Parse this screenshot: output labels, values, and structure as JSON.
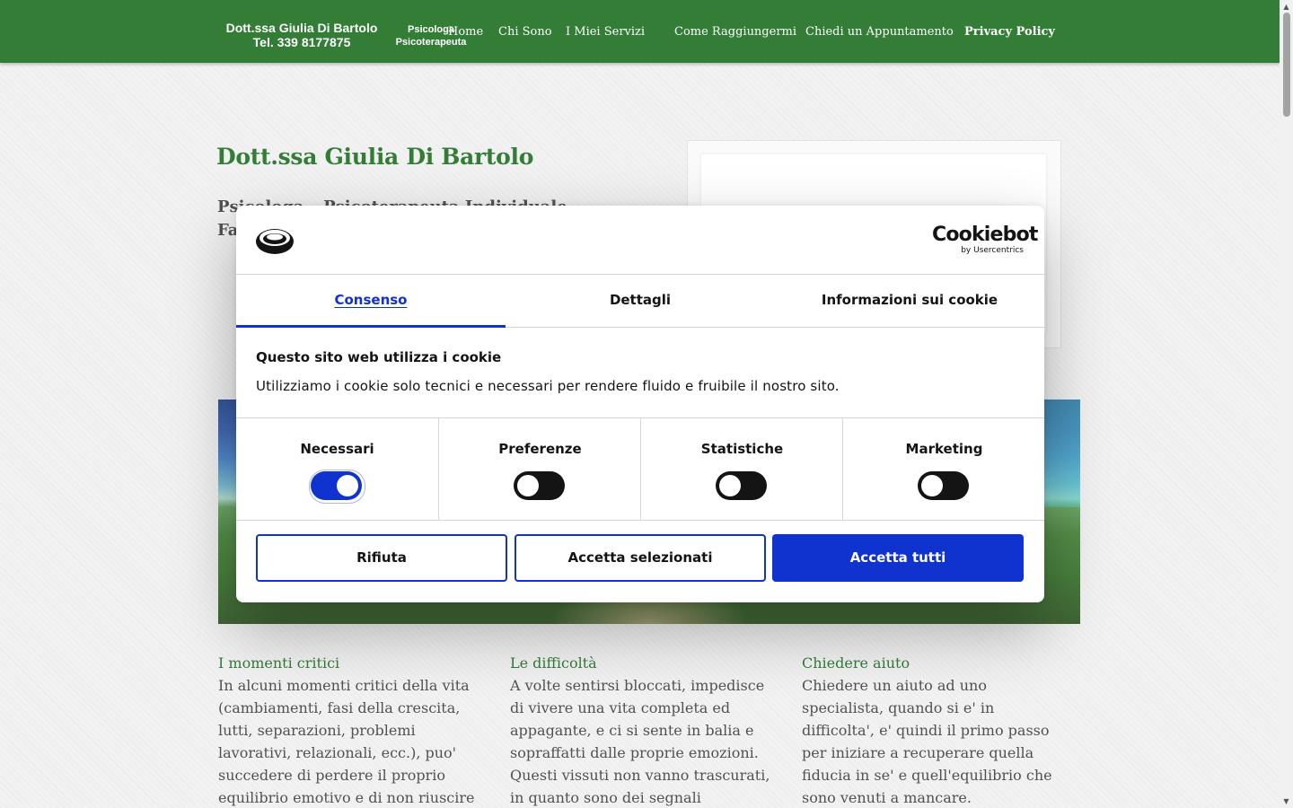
{
  "header": {
    "brand_name_line1": "Dott.ssa Giulia Di Bartolo",
    "brand_name_line2": "Tel. 339 8177875",
    "brand_role_line1": "Psicologa",
    "brand_role_line2": "Psicoterapeuta",
    "nav": [
      {
        "label": "Home"
      },
      {
        "label": "Chi Sono"
      },
      {
        "label": "I Miei Servizi"
      },
      {
        "label": "Come Raggiungermi"
      },
      {
        "label": "Chiedi un Appuntamento"
      },
      {
        "label": "Privacy Policy"
      }
    ]
  },
  "main": {
    "title": "Dott.ssa Giulia Di Bartolo",
    "subtitle": "Psicologa – Psicoterapeuta Individuale, Familiare e d",
    "columns": [
      {
        "title": "I momenti critici",
        "text": "In alcuni momenti critici della vita (cambiamenti, fasi della crescita, lutti, separazioni, problemi lavorativi, relazionali, ecc.), puo' succedere di perdere il proprio equilibrio emotivo e di non riuscire"
      },
      {
        "title": "Le difficoltà",
        "text": "A volte sentirsi bloccati, impedisce di vivere una vita completa ed appagante, e ci si sente in balia e sopraffatti dalle proprie emozioni. Questi vissuti non vanno trascurati, in quanto sono dei segnali"
      },
      {
        "title": "Chiedere aiuto",
        "text": "Chiedere un aiuto ad uno specialista, quando si e' in difficolta', e' quindi il primo passo per iniziare a recuperare quella fiducia in se' e quell'equilibrio che sono venuti a mancare."
      }
    ]
  },
  "cookie_dialog": {
    "brand_main": "Cookiebot",
    "brand_sub": "by Usercentrics",
    "tabs": [
      {
        "label": "Consenso",
        "active": true
      },
      {
        "label": "Dettagli",
        "active": false
      },
      {
        "label": "Informazioni sui cookie",
        "active": false
      }
    ],
    "title": "Questo sito web utilizza i cookie",
    "text": "Utilizziamo i cookie solo tecnici e necessari per rendere fluido e fruibile il nostro sito.",
    "categories": [
      {
        "label": "Necessari",
        "enabled": true
      },
      {
        "label": "Preferenze",
        "enabled": false
      },
      {
        "label": "Statistiche",
        "enabled": false
      },
      {
        "label": "Marketing",
        "enabled": false
      }
    ],
    "buttons": {
      "reject": "Rifiuta",
      "accept_selected": "Accetta selezionati",
      "accept_all": "Accetta tutti"
    }
  },
  "colors": {
    "header_green": "#176b1c",
    "cookiebot_blue": "#1032cf"
  }
}
